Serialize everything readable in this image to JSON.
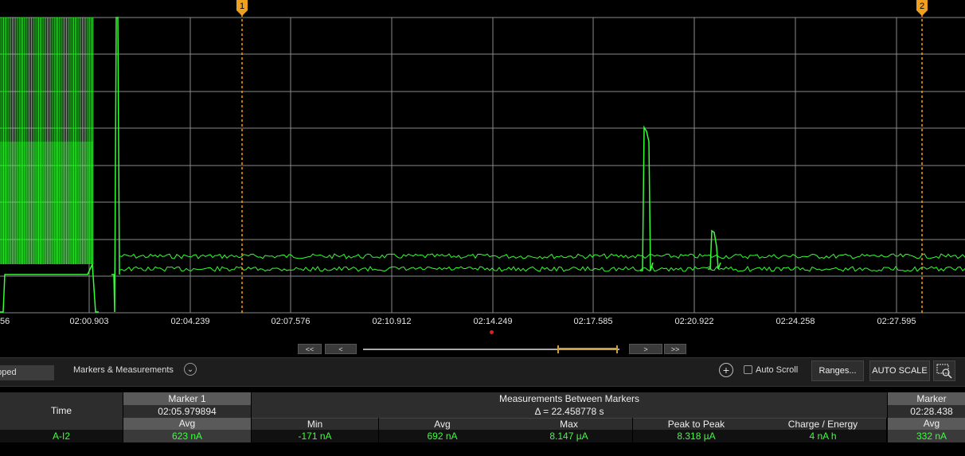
{
  "chart_data": {
    "type": "line",
    "x_ticks": [
      "56",
      "02:00.903",
      "02:04.239",
      "02:07.576",
      "02:10.912",
      "02:14.249",
      "02:17.585",
      "02:20.922",
      "02:24.258",
      "02:27.595"
    ],
    "series": [
      {
        "color": "#33ff33"
      }
    ],
    "grid": true,
    "markers": [
      {
        "label": "1",
        "color": "#f0a020"
      },
      {
        "label": "2",
        "color": "#f0a020"
      }
    ],
    "trigger_color": "#e02020"
  },
  "toolbar": {
    "status": "opped",
    "markers_label": "Markers & Measurements",
    "chevron_icon": "chevron-down-icon",
    "crosshair_icon": "crosshair-icon",
    "auto_scroll": "Auto Scroll",
    "ranges": "Ranges...",
    "auto_scale": "AUTO SCALE",
    "zoom_icon": "zoom-icon"
  },
  "scroll": {
    "first": "<<",
    "prev": "<",
    "next": ">",
    "last": ">>"
  },
  "table": {
    "row_labels": {
      "time": "Time",
      "channel": "A-I2"
    },
    "marker1": {
      "title": "Marker 1",
      "time": "02:05.979894",
      "stat": "Avg",
      "value": "623 nA"
    },
    "between": {
      "title": "Measurements Between Markers",
      "delta": "Δ = 22.458778 s",
      "columns": [
        {
          "label": "Min",
          "value": "-171 nA"
        },
        {
          "label": "Avg",
          "value": "692 nA"
        },
        {
          "label": "Max",
          "value": "8.147 µA"
        },
        {
          "label": "Peak to Peak",
          "value": "8.318 µA"
        },
        {
          "label": "Charge / Energy",
          "value": "4 nA h"
        }
      ]
    },
    "marker2": {
      "title": "Marker",
      "time": "02:28.438",
      "stat": "Avg",
      "value": "332 nA"
    }
  }
}
